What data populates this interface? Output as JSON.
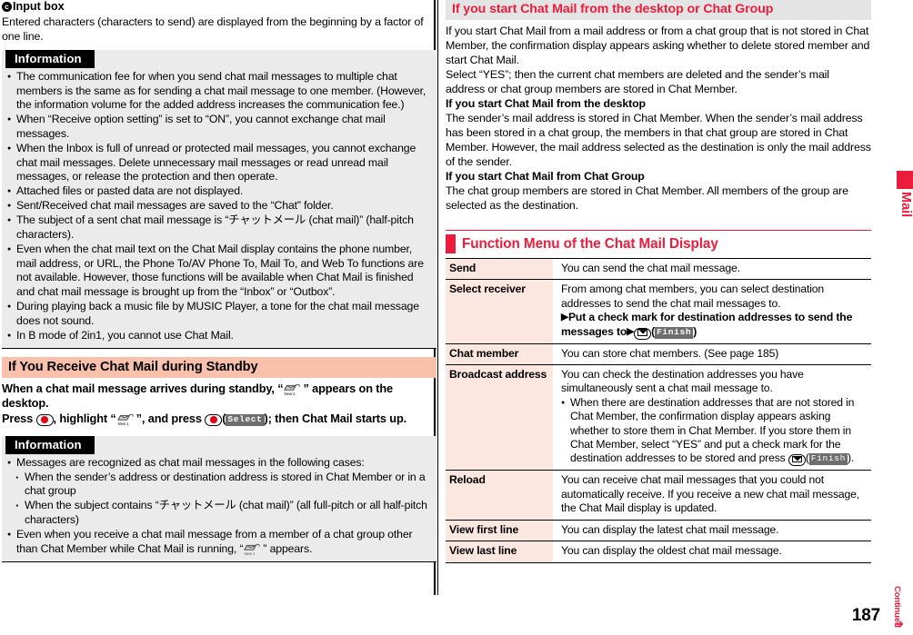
{
  "page": {
    "number": "187",
    "continued_label": "Continued",
    "side_tab_label": "Mail"
  },
  "left": {
    "input_box": {
      "marker": "c",
      "title": "Input box",
      "body": "Entered characters (characters to send) are displayed from the beginning by a factor of one line."
    },
    "information1": {
      "label": "Information",
      "items": [
        "The communication fee for when you send chat mail messages to multiple chat members is the same as for sending a chat mail message to one member. (However, the information volume for the added address increases the communication fee.)",
        "When “Receive option setting” is set to “ON”, you cannot exchange chat mail messages.",
        "When the Inbox is full of unread or protected mail messages, you cannot exchange chat mail messages. Delete unnecessary mail messages or read unread mail messages, or release the protection and then operate.",
        "Attached files or pasted data are not displayed.",
        "Sent/Received chat mail messages are saved to the “Chat” folder.",
        "The subject of a sent chat mail message is “チャットメール (chat mail)” (half-pitch characters).",
        "Even when the chat mail text on the Chat Mail display contains the phone number, mail address, or URL, the Phone To/AV Phone To, Mail To, and Web To functions are not available. However, those functions will be available when Chat Mail is finished and chat mail message is brought up from the “Inbox” or “Outbox”.",
        "During playing back a music file by MUSIC Player, a tone for the chat mail message does not sound.",
        "In B mode of 2in1, you cannot use Chat Mail."
      ]
    },
    "standby_section": {
      "heading": "If You Receive Chat Mail during Standby",
      "line1_a": "When a chat mail message arrives during standby, “",
      "line1_b": "” appears on the desktop.",
      "line2_a": "Press ",
      "line2_b": ", highlight “",
      "line2_c": "”, and press ",
      "line2_d": "(",
      "line2_softkey": "Select",
      "line2_e": "); then Chat Mail starts up."
    },
    "information2": {
      "label": "Information",
      "item1": "Messages are recognized as chat mail messages in the following cases:",
      "sub1": "When the sender’s address or destination address is stored in Chat Member or in a chat group",
      "sub2": "When the subject contains “チャットメール (chat mail)” (all full-pitch or all half-pitch characters)",
      "item2_a": "Even when you receive a chat mail message from a member of a chat group other than Chat Member while Chat Mail is running, “",
      "item2_b": "” appears."
    }
  },
  "right": {
    "desktop_section": {
      "heading": "If you start Chat Mail from the desktop or Chat Group",
      "p1": "If you start Chat Mail from a mail address or from a chat group that is not stored in Chat Member, the confirmation display appears asking whether to delete stored member and start Chat Mail.",
      "p2": "Select “YES”; then the current chat members are deleted and the sender’s mail address or chat group members are stored in Chat Member.",
      "sub1_title": "If you start Chat Mail from the desktop",
      "sub1_body": "The sender’s mail address is stored in Chat Member. When the sender’s mail address has been stored in a chat group, the members in that chat group are stored in Chat Member. However, the mail address selected as the destination is only the mail address of the sender.",
      "sub2_title": "If you start Chat Mail from Chat Group",
      "sub2_body": "The chat group members are stored in Chat Member. All members of the group are selected as the destination."
    },
    "function_menu": {
      "heading": "Function Menu of the Chat Mail Display",
      "rows": [
        {
          "label": "Send",
          "desc": "You can send the chat mail message."
        },
        {
          "label": "Select receiver",
          "desc": "From among chat members, you can select destination addresses to send the chat mail messages to.",
          "step_a": "Put a check mark for destination addresses to send the messages to",
          "step_softkey": "Finish"
        },
        {
          "label": "Chat member",
          "desc": "You can store chat members. (See page 185)"
        },
        {
          "label": "Broadcast address",
          "desc": "You can check the destination addresses you have simultaneously sent a chat mail message to.",
          "bullet_a": "When there are destination addresses that are not stored in Chat Member, the confirmation display appears asking whether to store them in Chat Member. If you store them in Chat Member, select “YES” and put a check mark for the destination addresses to be stored and press ",
          "bullet_softkey": "Finish",
          "bullet_b": ")."
        },
        {
          "label": "Reload",
          "desc": "You can receive chat mail messages that you could not automatically receive. If you receive a new chat mail message, the Chat Mail display is updated."
        },
        {
          "label": "View first line",
          "desc": "You can display the latest chat mail message."
        },
        {
          "label": "View last line",
          "desc": "You can display the oldest chat mail message."
        }
      ]
    }
  },
  "icons": {
    "mail_new_badge": "New 1",
    "center_key": "center-key-icon",
    "mail_key": "mail-key-icon"
  },
  "colors": {
    "accent_red": "#ec1c3c",
    "pink_header": "#f9c0ab",
    "table_label_bg": "#fce6e0",
    "info_bg": "#ebebeb",
    "grey_header": "#e4e4e4"
  }
}
